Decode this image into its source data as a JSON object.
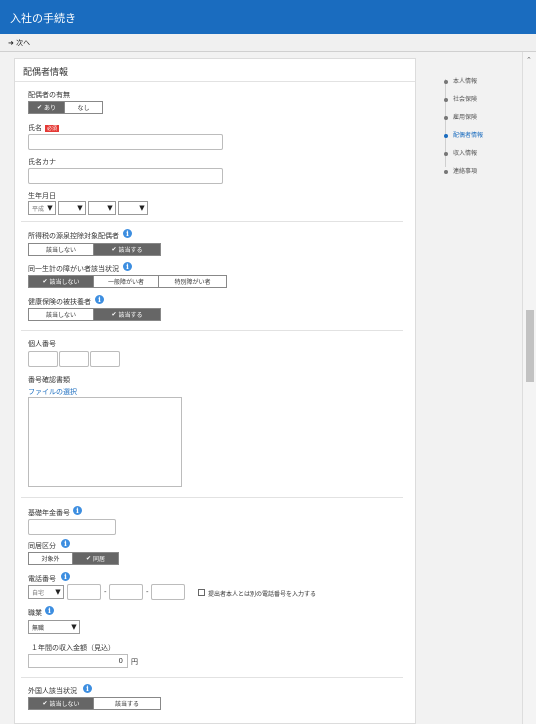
{
  "header": {
    "title": "入社の手続き"
  },
  "toolbar": {
    "next_label": "次へ"
  },
  "form": {
    "section_title": "配偶者情報",
    "spouse_presence": {
      "label": "配偶者の有無",
      "options": [
        "あり",
        "なし"
      ],
      "selected": 0
    },
    "name": {
      "label": "氏名",
      "required_badge": "必須",
      "value": ""
    },
    "name_kana": {
      "label": "氏名カナ",
      "value": ""
    },
    "birth_date": {
      "label": "生年月日",
      "era": "平成",
      "year": "",
      "month": "",
      "day": ""
    },
    "tax_dependent": {
      "label": "所得税の源泉控除対象配偶者",
      "options": [
        "該当しない",
        "該当する"
      ],
      "selected": 1
    },
    "disability": {
      "label": "同一生計の障がい者該当状況",
      "options": [
        "該当しない",
        "一般障がい者",
        "特別障がい者"
      ],
      "selected": 0
    },
    "health_insurance": {
      "label": "健康保険の被扶養者",
      "options": [
        "該当しない",
        "該当する"
      ],
      "selected": 1
    },
    "my_number": {
      "label": "個人番号",
      "parts": [
        "",
        "",
        ""
      ]
    },
    "id_document": {
      "label": "番号確認書類",
      "file_link": "ファイルの選択"
    },
    "pension_number": {
      "label": "基礎年金番号",
      "value": ""
    },
    "residence": {
      "label": "同居区分",
      "options": [
        "対象外",
        "同居"
      ],
      "selected": 1
    },
    "phone": {
      "label": "電話番号",
      "type": "自宅",
      "separator": "-",
      "checkbox_label": "提出者本人とは別の電話番号を入力する"
    },
    "occupation": {
      "label": "職業",
      "value": "無職"
    },
    "annual_income": {
      "label": "１年間の収入金額（見込）",
      "value": "0",
      "unit": "円"
    },
    "foreign_resident": {
      "label": "外国人該当状況",
      "options": [
        "該当しない",
        "該当する"
      ],
      "selected": 0
    }
  },
  "sidebar": {
    "steps": [
      {
        "label": "本人情報",
        "active": false
      },
      {
        "label": "社会保険",
        "active": false
      },
      {
        "label": "雇用保険",
        "active": false
      },
      {
        "label": "配偶者情報",
        "active": true
      },
      {
        "label": "収入情報",
        "active": false
      },
      {
        "label": "連絡事項",
        "active": false
      }
    ]
  },
  "icons": {
    "next": "arrow-right-icon",
    "info": "info-icon",
    "check": "check-icon",
    "dropdown": "chevron-down-icon"
  },
  "colors": {
    "header": "#1a6cbf",
    "selected_segment": "#666666",
    "required": "#e53935",
    "info": "#3d8ee0",
    "link": "#1a6cbf"
  }
}
